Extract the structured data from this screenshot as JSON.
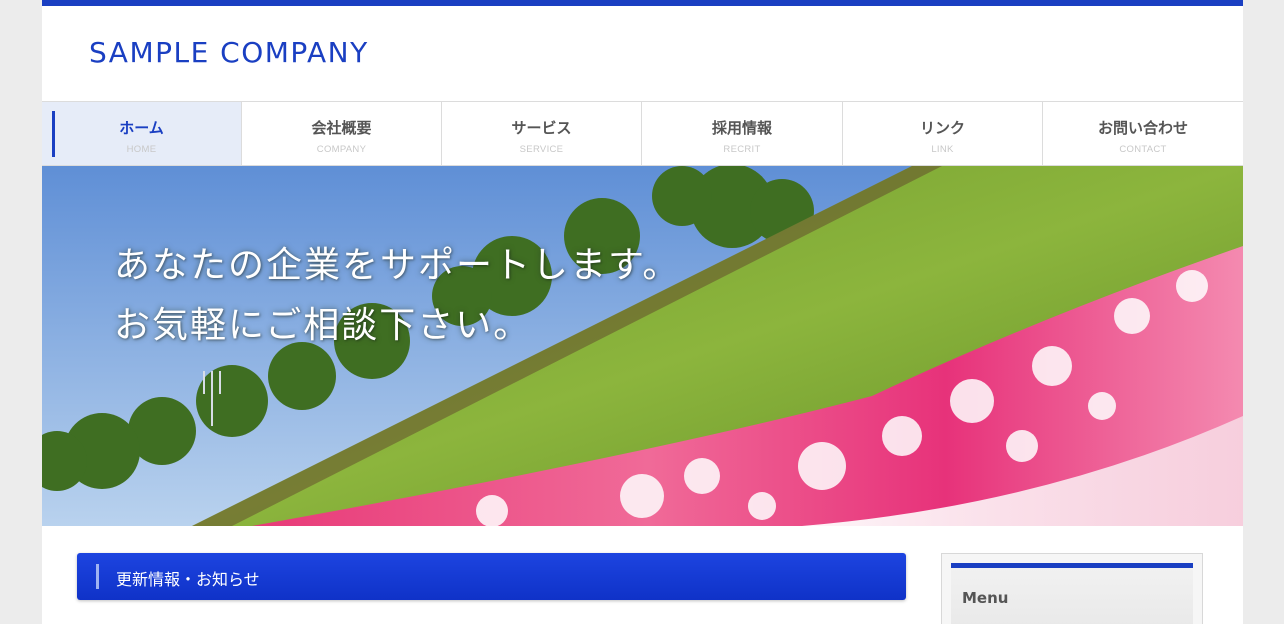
{
  "site": {
    "logo": "SAMPLE COMPANY",
    "accent_color": "#1a3fc2"
  },
  "nav": {
    "items": [
      {
        "label": "ホーム",
        "sub": "HOME",
        "active": true
      },
      {
        "label": "会社概要",
        "sub": "COMPANY",
        "active": false
      },
      {
        "label": "サービス",
        "sub": "SERVICE",
        "active": false
      },
      {
        "label": "採用情報",
        "sub": "RECRIT",
        "active": false
      },
      {
        "label": "リンク",
        "sub": "LINK",
        "active": false
      },
      {
        "label": "お問い合わせ",
        "sub": "CONTACT",
        "active": false
      }
    ]
  },
  "hero": {
    "line1": "あなたの企業をサポートします。",
    "line2": "お気軽にご相談下さい。"
  },
  "news": {
    "title": "更新情報・お知らせ"
  },
  "sidebar": {
    "menu_title": "Menu"
  }
}
